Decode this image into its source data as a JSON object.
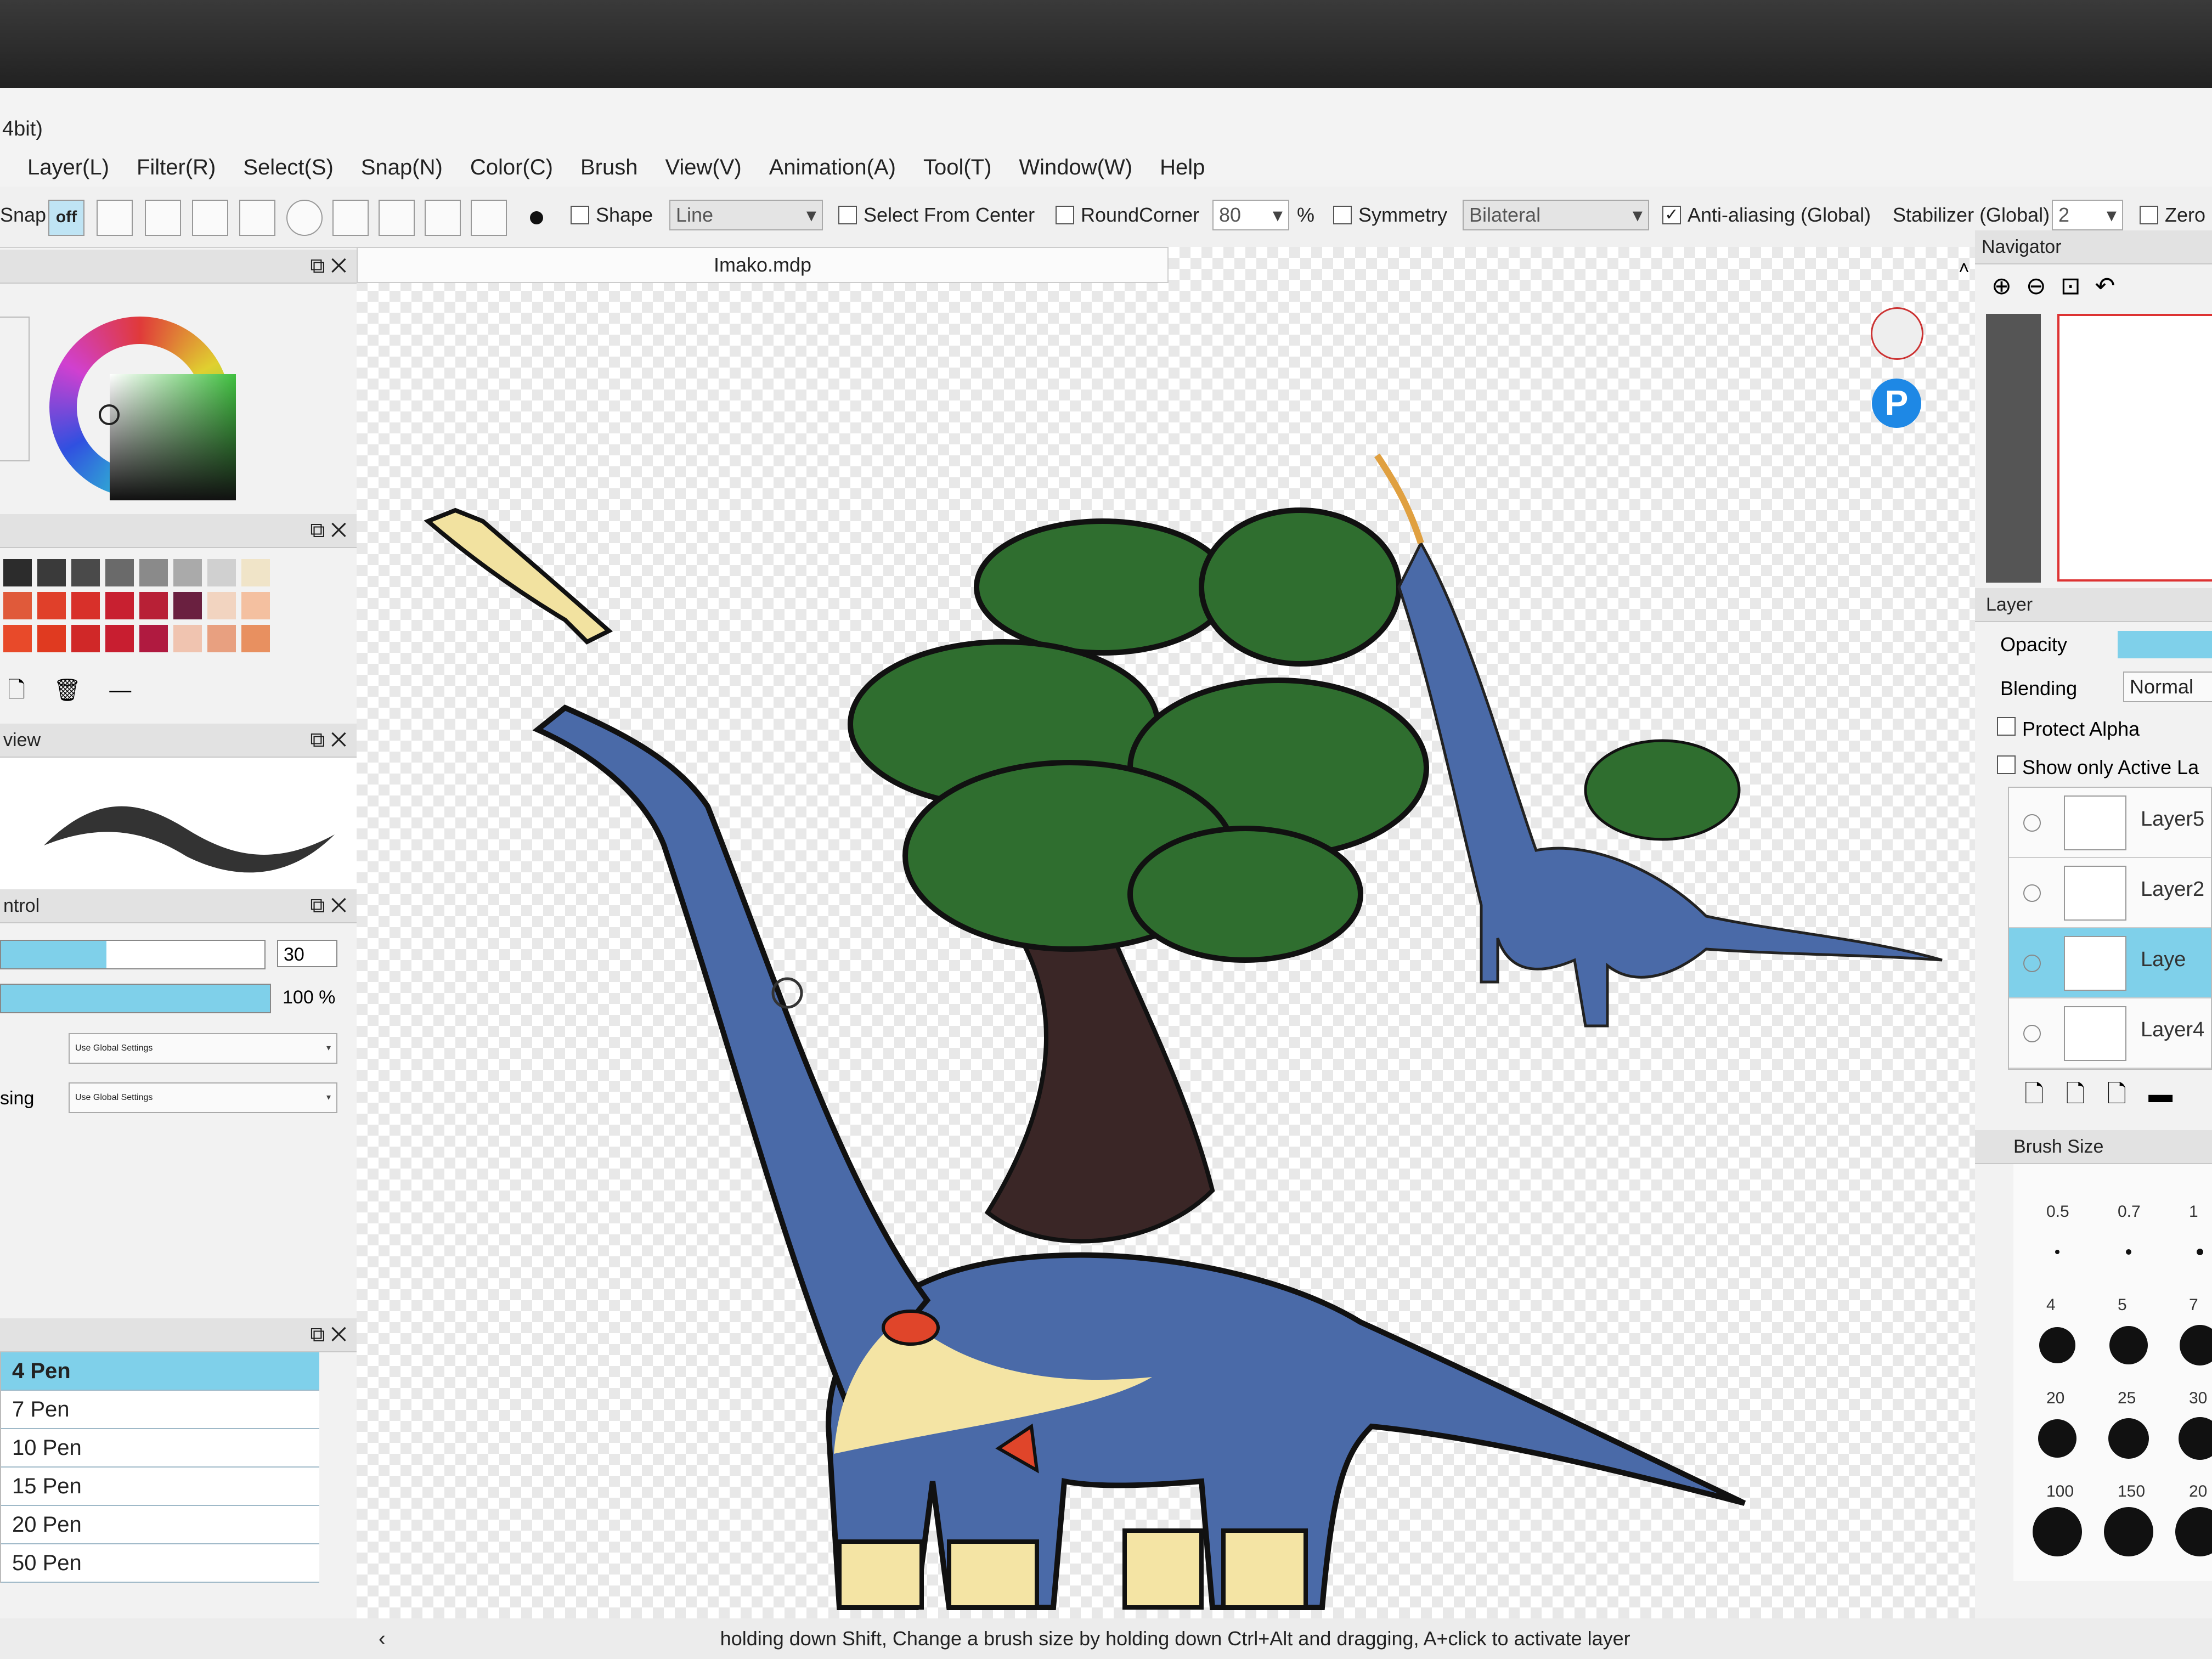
{
  "window": {
    "title_fragment": "4bit)"
  },
  "menu": [
    "Layer(L)",
    "Filter(R)",
    "Select(S)",
    "Snap(N)",
    "Color(C)",
    "Brush",
    "View(V)",
    "Animation(A)",
    "Tool(T)",
    "Window(W)",
    "Help"
  ],
  "toolbar": {
    "snap_label": "Snap",
    "snap_off": "off",
    "shape_label": "Shape",
    "shape_value": "Line",
    "select_from_center": "Select From Center",
    "round_corner": "RoundCorner",
    "round_corner_value": "80",
    "percent": "%",
    "symmetry": "Symmetry",
    "symmetry_value": "Bilateral",
    "anti_aliasing": "Anti-aliasing (Global)",
    "stabilizer": "Stabilizer (Global)",
    "stabilizer_value": "2",
    "zero": "Zero"
  },
  "document_tab": "Imako.mdp",
  "left_panels": {
    "preview_title": "view",
    "control_title": "ntrol",
    "size_value": "30",
    "opacity_value": "100 %",
    "setting1_value": "Use Global Settings",
    "setting2_label": "sing",
    "setting2_value": "Use Global Settings",
    "palette_colors": [
      "#2c2c2c",
      "#3a3a3a",
      "#4a4a4a",
      "#6a6a6a",
      "#8a8a8a",
      "#aaaaaa",
      "#d0d0d0",
      "#f0e4c8",
      "#e05a3a",
      "#e0402a",
      "#d8302a",
      "#c82030",
      "#b82036",
      "#6a2040",
      "#f2d4c0",
      "#f4c0a0",
      "#e84a2a",
      "#e03a20",
      "#d02828",
      "#c81e30",
      "#b01a40",
      "#f0c4b0",
      "#e8a080",
      "#e89060"
    ]
  },
  "brushes": [
    {
      "label": "4 Pen",
      "selected": true
    },
    {
      "label": "7 Pen",
      "selected": false
    },
    {
      "label": "10 Pen",
      "selected": false
    },
    {
      "label": "15 Pen",
      "selected": false
    },
    {
      "label": "20 Pen",
      "selected": false
    },
    {
      "label": "50 Pen",
      "selected": false
    }
  ],
  "navigator": {
    "title": "Navigator"
  },
  "layer_panel": {
    "title": "Layer",
    "opacity_label": "Opacity",
    "blending_label": "Blending",
    "blending_value": "Normal",
    "protect_alpha": "Protect Alpha",
    "show_only_active": "Show only Active La",
    "layers": [
      {
        "name": "Layer5",
        "selected": false
      },
      {
        "name": "Layer2",
        "selected": false
      },
      {
        "name": "Laye",
        "selected": true
      },
      {
        "name": "Layer4",
        "selected": false
      }
    ]
  },
  "brush_size": {
    "title": "Brush Size",
    "sizes": [
      "0.5",
      "0.7",
      "1",
      "4",
      "5",
      "7",
      "20",
      "25",
      "30",
      "100",
      "150",
      "20"
    ]
  },
  "status_bar": "holding down Shift, Change a brush size by holding down Ctrl+Alt and dragging, A+click to activate layer"
}
